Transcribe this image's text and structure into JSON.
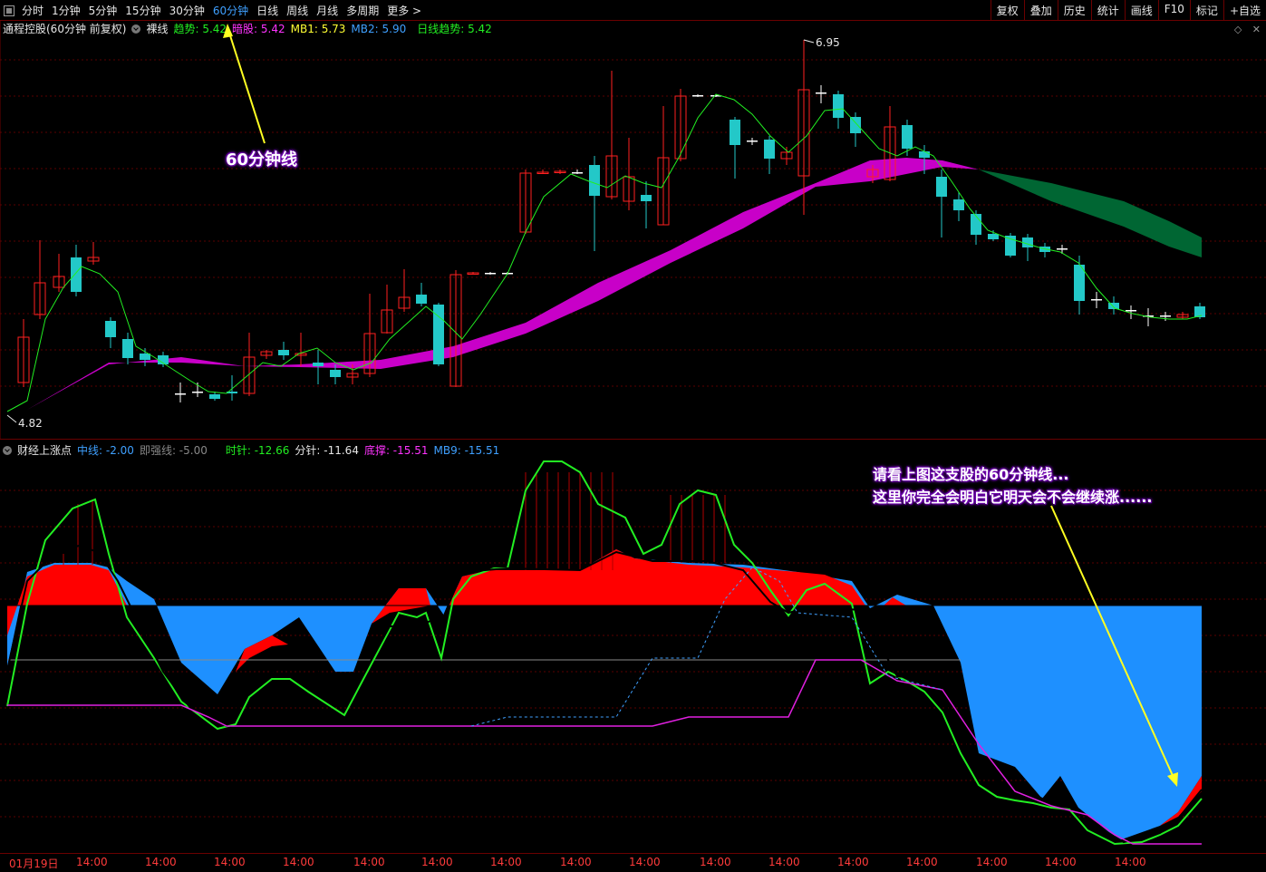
{
  "toolbar": {
    "periods": [
      "分时",
      "1分钟",
      "5分钟",
      "15分钟",
      "30分钟",
      "60分钟",
      "日线",
      "周线",
      "月线",
      "多周期",
      "更多 >"
    ],
    "active_period": "60分钟",
    "right_buttons": [
      "复权",
      "叠加",
      "历史",
      "统计",
      "画线",
      "F10",
      "标记",
      "+自选"
    ]
  },
  "main_info": {
    "title": "通程控股(60分钟 前复权)",
    "mode": "裸线",
    "trend": "趋势: 5.42",
    "dark": "暗股: 5.42",
    "mb1": "MB1: 5.73",
    "mb2": "MB2: 5.90",
    "day_trend": "日线趋势: 5.42"
  },
  "corner_icons": [
    "diamond-icon",
    "close-icon"
  ],
  "main_chart": {
    "high_label": "6.95",
    "low_label": "4.82"
  },
  "sub_info": {
    "title": "财经上涨点",
    "mid": "中线: -2.00",
    "strength": "即强线: -5.00",
    "hour": "时针: -12.66",
    "minute": "分针: -11.64",
    "bottom": "底撑: -15.51",
    "mb9": "MB9: -15.51"
  },
  "annotations": {
    "a1": "60分钟线",
    "a2_line1": "请看上图这支股的60分钟线...",
    "a2_line2": "这里你完全会明白它明天会不会继续涨......"
  },
  "xaxis": [
    "01月19日",
    "14:00",
    "14:00",
    "14:00",
    "14:00",
    "14:00",
    "14:00",
    "14:00",
    "14:00",
    "14:00",
    "14:00",
    "14:00",
    "14:00",
    "14:00",
    "14:00",
    "14:00",
    "14:00"
  ],
  "colors": {
    "up": "#ff2020",
    "down": "#23c8c8",
    "ribbon": "#c800c8",
    "ribbon_future": "#006633",
    "accent": "#3fa0ff",
    "fill_blue": "#1e90ff",
    "fill_red": "#ff0000",
    "line_green": "#22ee22"
  }
}
